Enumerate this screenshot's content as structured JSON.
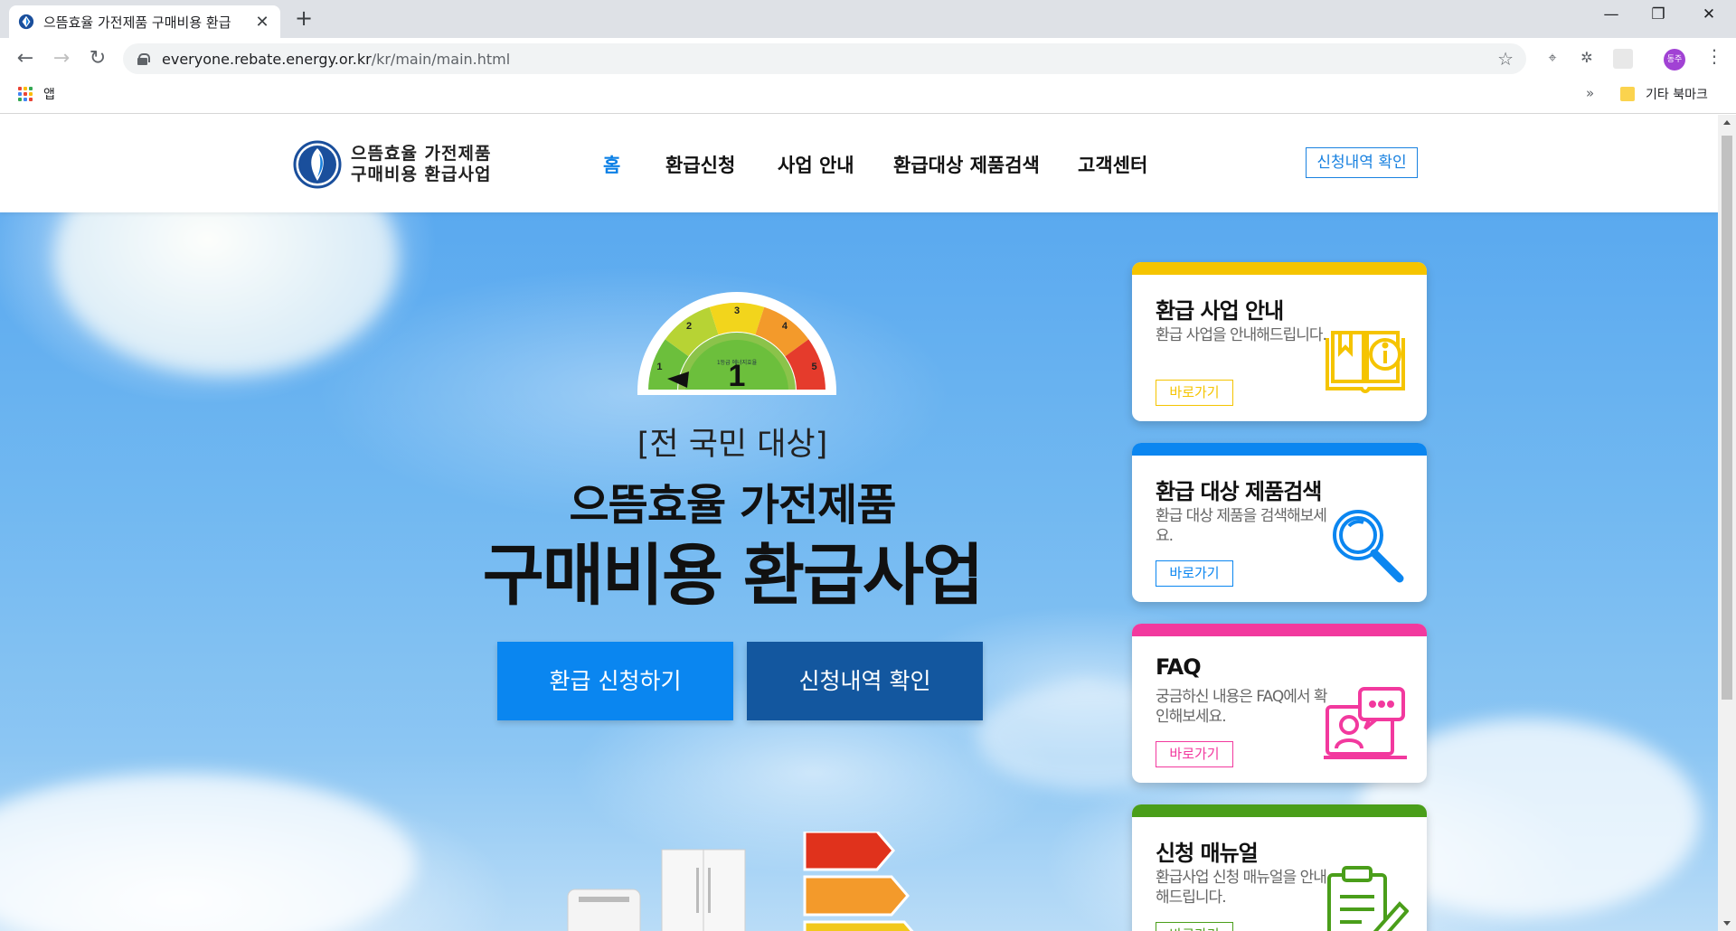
{
  "browser": {
    "tab_title": "으뜸효율 가전제품 구매비용 환급",
    "tab_close": "✕",
    "new_tab": "+",
    "url_host": "everyone.rebate.energy.or.kr",
    "url_path": "/kr/main/main.html",
    "avatar_text": "동주",
    "bookmarks": {
      "apps_label": "앱",
      "more": "»",
      "other_label": "기타 북마크"
    },
    "colors": {
      "apps_grid": [
        "#ea4335",
        "#fbbc05",
        "#34a853",
        "#4285f4",
        "#ea4335",
        "#fbbc05",
        "#34a853",
        "#4285f4",
        "#ea4335"
      ]
    }
  },
  "header": {
    "logo_line1": "으뜸효율 가전제품",
    "logo_line2": "구매비용 환급사업",
    "nav": [
      "홈",
      "환급신청",
      "사업 안내",
      "환급대상 제품검색",
      "고객센터"
    ],
    "active_nav": "홈",
    "check_button": "신청내역 확인"
  },
  "hero": {
    "subtitle": "[전 국민 대상]",
    "title_line1": "으뜸효율 가전제품",
    "title_line2": "구매비용 환급사업",
    "apply_button": "환급 신청하기",
    "check_button": "신청내역 확인",
    "gauge": {
      "segments": [
        "1",
        "2",
        "3",
        "4",
        "5"
      ],
      "value": "1",
      "colors": [
        "#6cbf3c",
        "#b7d334",
        "#f2d51c",
        "#f39a2b",
        "#e53b2c"
      ]
    }
  },
  "cards": [
    {
      "title": "환급 사업 안내",
      "desc": "환급 사업을 안내해드립니다.",
      "button": "바로가기",
      "color": "#f5c400",
      "icon": "book-info-icon"
    },
    {
      "title": "환급 대상 제품검색",
      "desc": "환급 대상 제품을 검색해보세요.",
      "button": "바로가기",
      "color": "#0b86f0",
      "icon": "search-icon"
    },
    {
      "title": "FAQ",
      "desc": "궁금하신 내용은 FAQ에서 확인해보세요.",
      "button": "바로가기",
      "color": "#f2399e",
      "icon": "faq-chat-icon"
    },
    {
      "title": "신청 매뉴얼",
      "desc": "환급사업 신청 매뉴얼을 안내해드립니다.",
      "button": "바로가기",
      "color": "#4a9e1a",
      "icon": "clipboard-icon"
    }
  ]
}
